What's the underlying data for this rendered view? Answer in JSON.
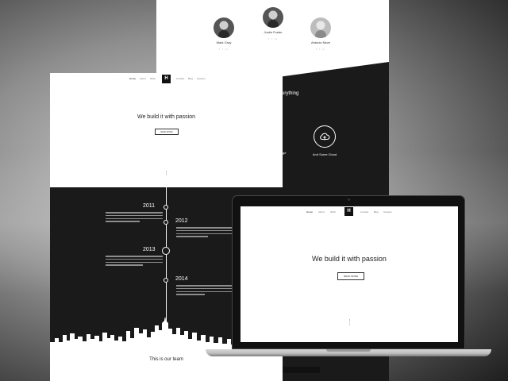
{
  "back_page": {
    "team": [
      {
        "name": "Mark Gray",
        "role": "",
        "social": "f  t  in",
        "tone": "dark"
      },
      {
        "name": "Justin Foster",
        "role": "",
        "social": "f  t  in",
        "tone": "dark"
      },
      {
        "name": "Antonio Neve",
        "role": "",
        "social": "f  t  in",
        "tone": "light"
      }
    ],
    "partial_heading": "erything",
    "partial_label": "ge",
    "cloud_label": "And Some Cloud"
  },
  "front_page": {
    "nav": {
      "left": [
        "Home",
        "About",
        "Work"
      ],
      "right": [
        "Contact",
        "Blog",
        "Careers"
      ],
      "logo": "H"
    },
    "hero": {
      "title": "We build it with passion",
      "subtitle": "",
      "button": "READ MORE"
    },
    "timeline": [
      {
        "year": "2011",
        "side": "left"
      },
      {
        "year": "2012",
        "side": "right"
      },
      {
        "year": "2013",
        "side": "left"
      },
      {
        "year": "2014",
        "side": "right"
      }
    ],
    "team_title": "This is our team",
    "team_subtitle": ""
  },
  "laptop": {
    "nav": {
      "left": [
        "Home",
        "About",
        "Work"
      ],
      "right": [
        "Contact",
        "Blog",
        "Careers"
      ],
      "logo": "H"
    },
    "hero": {
      "title": "We build it with passion",
      "subtitle": "",
      "button": "READ MORE"
    }
  }
}
